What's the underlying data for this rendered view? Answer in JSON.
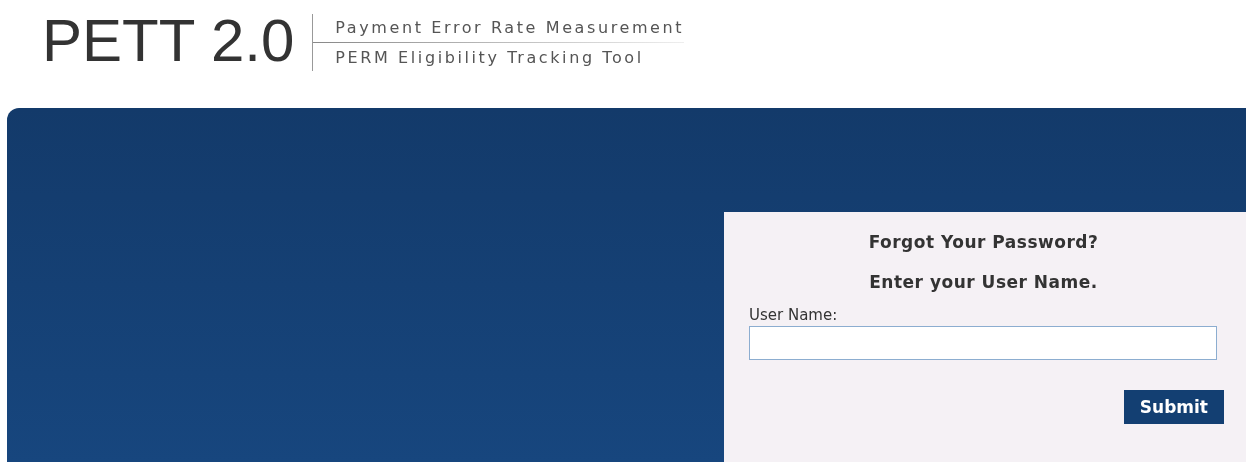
{
  "header": {
    "logo": "PETT 2.0",
    "taglines": [
      "Payment Error Rate Measurement",
      "PERM Eligibility Tracking Tool"
    ]
  },
  "form": {
    "title": "Forgot Your Password?",
    "instruction": "Enter your User Name.",
    "field_label": "User Name:",
    "submit": "Submit"
  }
}
